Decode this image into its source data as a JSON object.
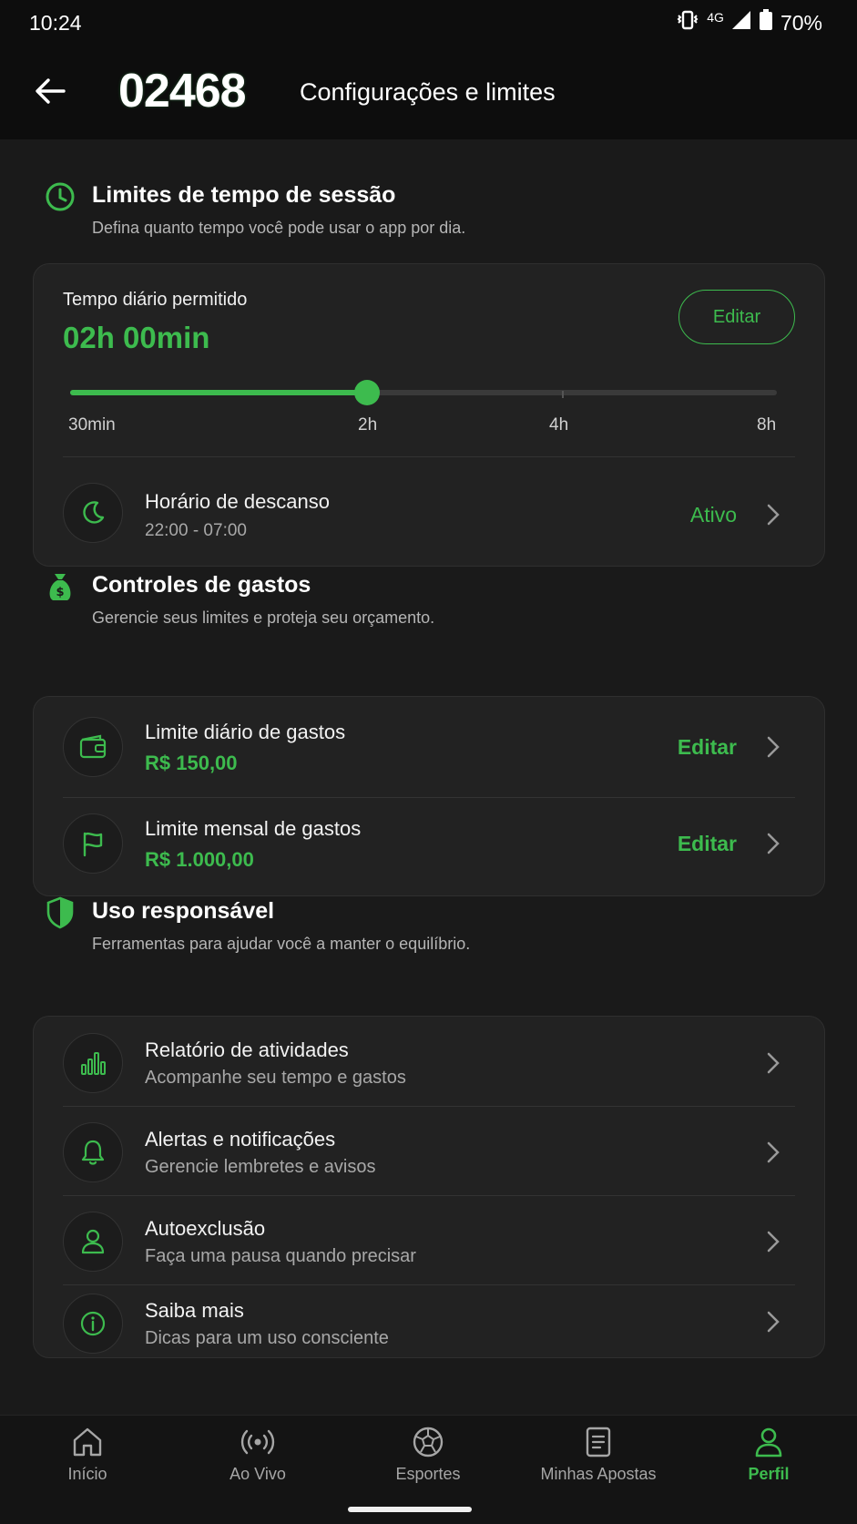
{
  "status": {
    "time": "10:24",
    "network": "4G",
    "battery": "70%"
  },
  "header": {
    "logo": "02468",
    "title": "Configurações e limites"
  },
  "session": {
    "title": "Limites de tempo de sessão",
    "subtitle": "Defina quanto tempo você pode usar o app por dia.",
    "allowed_label": "Tempo diário permitido",
    "allowed_value": "02h 00min",
    "edit_label": "Editar",
    "slider_value_fraction": 0.42,
    "slider_ticks": [
      "30min",
      "2h",
      "4h",
      "8h"
    ],
    "rest_title": "Horário de descanso",
    "rest_time": "22:00 - 07:00",
    "rest_status": "Ativo"
  },
  "spending": {
    "title": "Controles de gastos",
    "subtitle": "Gerencie seus limites e proteja seu orçamento.",
    "items": [
      {
        "title": "Limite diário de gastos",
        "value": "R$ 150,00",
        "action": "Editar",
        "icon": "wallet-icon"
      },
      {
        "title": "Limite mensal de gastos",
        "value": "R$ 1.000,00",
        "action": "Editar",
        "icon": "flag-icon"
      }
    ]
  },
  "responsible": {
    "title": "Uso responsável",
    "subtitle": "Ferramentas para ajudar você a manter o equilíbrio.",
    "items": [
      {
        "title": "Relatório de atividades",
        "subtitle": "Acompanhe seu tempo e gastos",
        "icon": "bar-chart-icon"
      },
      {
        "title": "Alertas e notificações",
        "subtitle": "Gerencie lembretes e avisos",
        "icon": "bell-icon"
      },
      {
        "title": "Autoexclusão",
        "subtitle": "Faça uma pausa quando precisar",
        "icon": "user-icon"
      },
      {
        "title": "Saiba mais",
        "subtitle": "Dicas para um uso consciente",
        "icon": "info-icon"
      }
    ]
  },
  "tabs": [
    {
      "label": "Início",
      "icon": "home-icon"
    },
    {
      "label": "Ao Vivo",
      "icon": "live-icon"
    },
    {
      "label": "Esportes",
      "icon": "soccer-ball-icon"
    },
    {
      "label": "Minhas Apostas",
      "icon": "ticket-icon"
    },
    {
      "label": "Perfil",
      "icon": "profile-icon",
      "active": true
    }
  ],
  "colors": {
    "accent": "#3dbb4e",
    "background": "#1a1a1a",
    "card": "#222222"
  }
}
